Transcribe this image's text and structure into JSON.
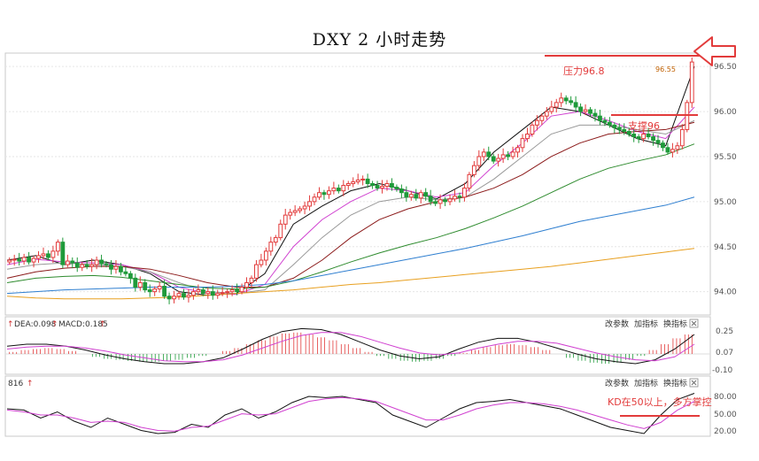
{
  "title": "DXY 2 小时走势",
  "annotations": {
    "resistance": "压力96.8",
    "support": "支撑96",
    "kd_note": "KD在50以上，多方掌控",
    "price_tag": "96.55"
  },
  "panels": {
    "macd": {
      "dea_label": "DEA:0.098",
      "macd_label": "MACD:0.185",
      "buttons": [
        "改参数",
        "加指标",
        "换指标"
      ],
      "yticks": [
        "0.25",
        "0.07",
        "-0.10"
      ]
    },
    "kd": {
      "value_label": "816",
      "buttons": [
        "改参数",
        "加指标",
        "换指标"
      ],
      "yticks": [
        "80.00",
        "50.00",
        "20.00"
      ]
    }
  },
  "colors": {
    "up": "#e23b3b",
    "down": "#1f9a3a",
    "annotation": "#e23b3b"
  },
  "chart_data": {
    "type": "candlestick",
    "title": "DXY 2 小时走势",
    "ylim": [
      93.8,
      96.6
    ],
    "yticks": [
      94.0,
      94.5,
      95.0,
      95.5,
      96.0,
      96.5
    ],
    "ytick_labels": [
      "94.00",
      "94.50",
      "95.00",
      "95.50",
      "96.00",
      "96.50"
    ],
    "resistance_level": 96.8,
    "support_level": 96.0,
    "close_series": [
      94.35,
      94.36,
      94.34,
      94.38,
      94.33,
      94.37,
      94.4,
      94.42,
      94.38,
      94.45,
      94.55,
      94.3,
      94.34,
      94.32,
      94.27,
      94.3,
      94.28,
      94.3,
      94.35,
      94.31,
      94.3,
      94.25,
      94.28,
      94.22,
      94.2,
      94.15,
      94.05,
      94.1,
      94.02,
      94.0,
      94.03,
      94.06,
      93.95,
      93.92,
      93.95,
      93.98,
      93.94,
      93.96,
      94.0,
      94.02,
      93.98,
      94.0,
      93.96,
      93.98,
      93.99,
      94.0,
      94.02,
      94.0,
      94.05,
      94.1,
      94.15,
      94.3,
      94.35,
      94.45,
      94.55,
      94.6,
      94.75,
      94.85,
      94.88,
      94.9,
      94.92,
      94.95,
      95.0,
      95.05,
      95.1,
      95.08,
      95.12,
      95.15,
      95.12,
      95.18,
      95.2,
      95.22,
      95.24,
      95.25,
      95.2,
      95.18,
      95.15,
      95.17,
      95.2,
      95.16,
      95.14,
      95.1,
      95.05,
      95.08,
      95.04,
      95.1,
      95.06,
      95.0,
      94.98,
      95.02,
      95.0,
      95.03,
      95.06,
      95.05,
      95.15,
      95.3,
      95.4,
      95.5,
      95.55,
      95.5,
      95.45,
      95.48,
      95.52,
      95.5,
      95.55,
      95.6,
      95.7,
      95.75,
      95.85,
      95.9,
      95.95,
      96.0,
      96.05,
      96.1,
      96.15,
      96.12,
      96.1,
      96.05,
      96.0,
      96.02,
      95.98,
      95.95,
      95.9,
      95.88,
      95.85,
      95.82,
      95.8,
      95.78,
      95.75,
      95.72,
      95.7,
      95.75,
      95.72,
      95.68,
      95.65,
      95.6,
      95.55,
      95.58,
      95.62,
      95.8,
      96.1,
      96.55
    ],
    "ma_series": [
      {
        "color": "#111111",
        "values": [
          94.35,
          94.4,
          94.3,
          94.35,
          94.3,
          94.2,
          94.0,
          93.96,
          93.98,
          94.2,
          94.75,
          94.95,
          95.12,
          95.2,
          95.12,
          95.03,
          95.2,
          95.55,
          95.8,
          96.05,
          96.0,
          95.85,
          95.7,
          95.62,
          96.5
        ]
      },
      {
        "color": "#d040d0",
        "values": [
          94.3,
          94.36,
          94.33,
          94.32,
          94.3,
          94.22,
          94.05,
          93.98,
          93.97,
          94.08,
          94.5,
          94.8,
          95.0,
          95.15,
          95.12,
          95.05,
          95.1,
          95.4,
          95.65,
          95.95,
          96.0,
          95.9,
          95.78,
          95.7,
          96.05
        ]
      },
      {
        "color": "#999999",
        "values": [
          94.25,
          94.3,
          94.32,
          94.3,
          94.28,
          94.22,
          94.1,
          94.0,
          93.98,
          94.02,
          94.3,
          94.6,
          94.85,
          95.0,
          95.05,
          95.02,
          95.05,
          95.25,
          95.5,
          95.75,
          95.85,
          95.85,
          95.8,
          95.75,
          95.9
        ]
      },
      {
        "color": "#8b1a1a",
        "values": [
          94.15,
          94.22,
          94.26,
          94.28,
          94.28,
          94.25,
          94.18,
          94.1,
          94.05,
          94.05,
          94.15,
          94.35,
          94.6,
          94.8,
          94.92,
          95.0,
          95.05,
          95.15,
          95.3,
          95.5,
          95.65,
          95.75,
          95.78,
          95.8,
          95.88
        ]
      },
      {
        "color": "#2e8b2e",
        "values": [
          94.1,
          94.15,
          94.17,
          94.18,
          94.16,
          94.12,
          94.08,
          94.04,
          94.03,
          94.05,
          94.12,
          94.22,
          94.33,
          94.43,
          94.52,
          94.6,
          94.7,
          94.82,
          94.95,
          95.1,
          95.25,
          95.37,
          95.45,
          95.52,
          95.64
        ]
      },
      {
        "color": "#2f7fd0",
        "values": [
          93.98,
          94.0,
          94.02,
          94.03,
          94.04,
          94.05,
          94.05,
          94.05,
          94.06,
          94.08,
          94.12,
          94.18,
          94.24,
          94.3,
          94.36,
          94.42,
          94.48,
          94.55,
          94.62,
          94.7,
          94.78,
          94.84,
          94.9,
          94.96,
          95.05
        ]
      },
      {
        "color": "#e8a020",
        "values": [
          93.95,
          93.93,
          93.92,
          93.92,
          93.92,
          93.93,
          93.94,
          93.96,
          93.98,
          94.0,
          94.02,
          94.05,
          94.08,
          94.1,
          94.13,
          94.16,
          94.19,
          94.22,
          94.25,
          94.28,
          94.32,
          94.36,
          94.4,
          94.44,
          94.48
        ]
      }
    ],
    "macd_hist": [
      0.02,
      0.04,
      0.05,
      0.06,
      0.05,
      0.03,
      0.0,
      -0.03,
      -0.05,
      -0.06,
      -0.07,
      -0.08,
      -0.08,
      -0.07,
      -0.06,
      -0.04,
      -0.02,
      0.0,
      0.03,
      0.06,
      0.1,
      0.14,
      0.18,
      0.21,
      0.22,
      0.2,
      0.17,
      0.14,
      0.1,
      0.06,
      0.02,
      -0.02,
      -0.05,
      -0.07,
      -0.08,
      -0.07,
      -0.05,
      -0.02,
      0.01,
      0.04,
      0.07,
      0.09,
      0.1,
      0.09,
      0.07,
      0.04,
      0.0,
      -0.04,
      -0.07,
      -0.09,
      -0.1,
      -0.09,
      -0.06,
      -0.02,
      0.04,
      0.1,
      0.16,
      0.2
    ],
    "macd_dif": [
      0.08,
      0.1,
      0.1,
      0.08,
      0.04,
      -0.01,
      -0.05,
      -0.08,
      -0.1,
      -0.1,
      -0.08,
      -0.04,
      0.05,
      0.15,
      0.23,
      0.26,
      0.25,
      0.2,
      0.12,
      0.04,
      -0.02,
      -0.05,
      -0.03,
      0.05,
      0.12,
      0.16,
      0.16,
      0.12,
      0.06,
      0.0,
      -0.05,
      -0.08,
      -0.1,
      -0.06,
      0.05,
      0.2
    ],
    "macd_dea": [
      0.05,
      0.07,
      0.08,
      0.08,
      0.06,
      0.03,
      -0.01,
      -0.04,
      -0.07,
      -0.08,
      -0.08,
      -0.06,
      -0.01,
      0.06,
      0.13,
      0.19,
      0.22,
      0.22,
      0.18,
      0.12,
      0.06,
      0.01,
      -0.01,
      0.01,
      0.06,
      0.1,
      0.13,
      0.13,
      0.11,
      0.06,
      0.01,
      -0.03,
      -0.06,
      -0.07,
      -0.03,
      0.1
    ],
    "kd_k": [
      60,
      58,
      45,
      55,
      40,
      30,
      45,
      35,
      25,
      20,
      22,
      35,
      30,
      50,
      60,
      45,
      55,
      70,
      80,
      78,
      80,
      75,
      70,
      50,
      40,
      30,
      45,
      60,
      70,
      72,
      75,
      70,
      65,
      60,
      50,
      40,
      30,
      25,
      20,
      50,
      75,
      85
    ],
    "kd_d": [
      58,
      55,
      50,
      50,
      45,
      38,
      40,
      38,
      30,
      25,
      24,
      30,
      32,
      42,
      52,
      50,
      52,
      62,
      72,
      76,
      78,
      76,
      72,
      62,
      52,
      42,
      42,
      50,
      60,
      66,
      70,
      70,
      68,
      64,
      58,
      50,
      42,
      34,
      28,
      38,
      58,
      72
    ]
  }
}
